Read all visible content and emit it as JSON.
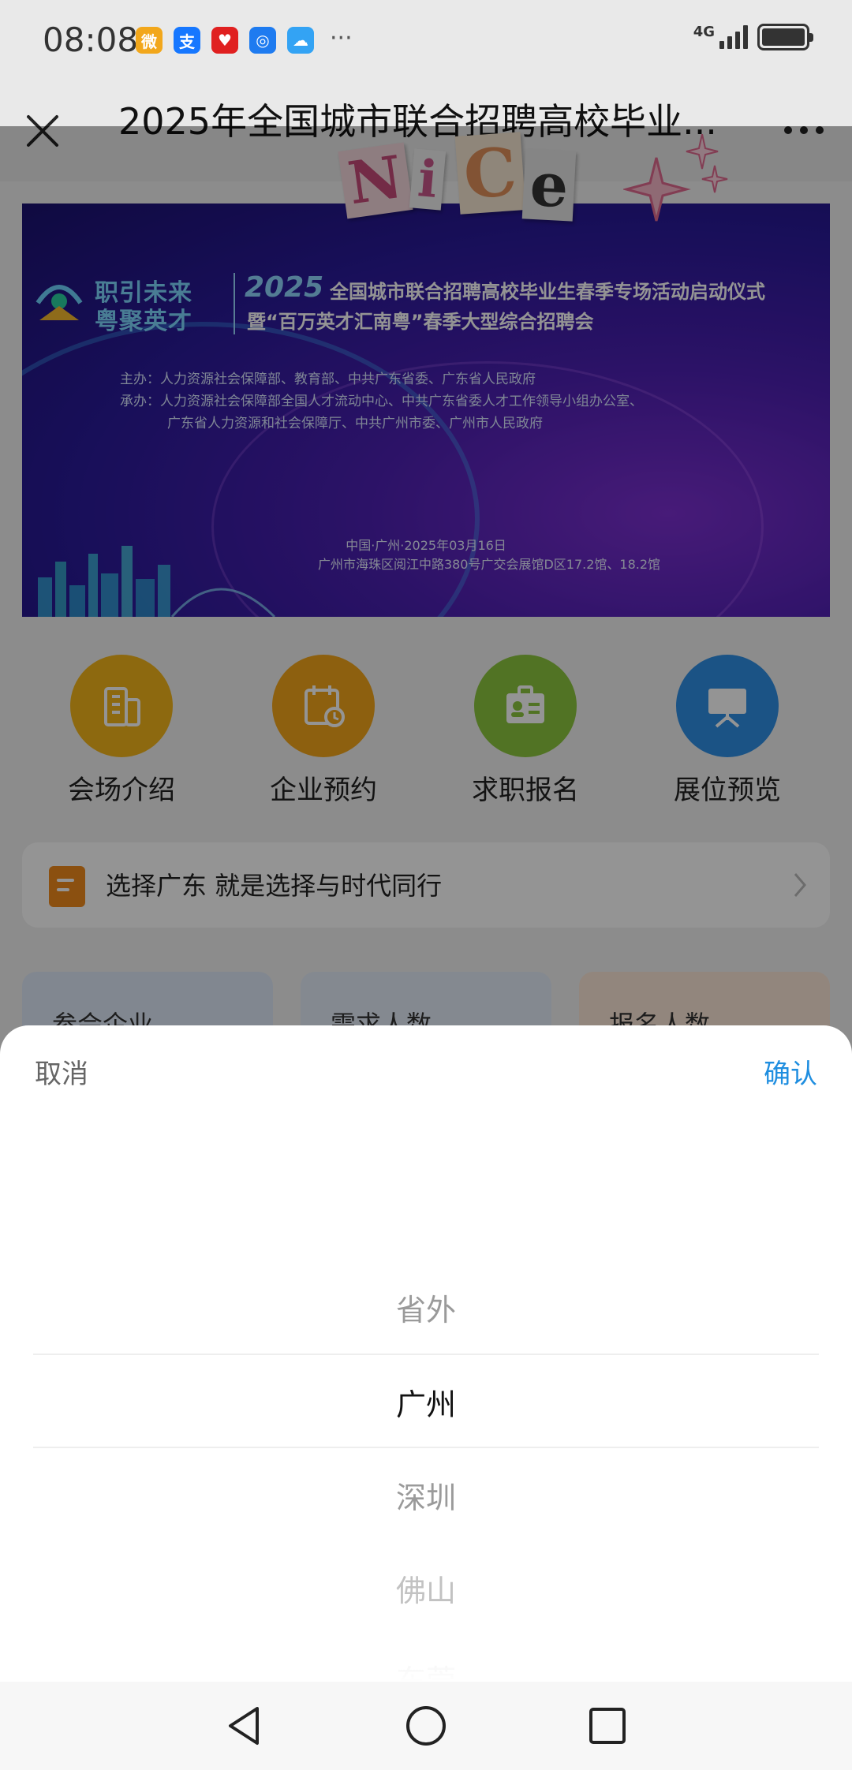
{
  "status_bar": {
    "time": "08:08",
    "network": "4G",
    "apps": [
      {
        "name": "weibo-icon",
        "color": "#f2a71b",
        "glyph": "微"
      },
      {
        "name": "alipay-icon",
        "color": "#1677ff",
        "glyph": "支"
      },
      {
        "name": "app-red-icon",
        "color": "#e02020",
        "glyph": "♥"
      },
      {
        "name": "app-blue-icon",
        "color": "#1e7bf0",
        "glyph": "◎"
      },
      {
        "name": "weather-icon",
        "color": "#33a3f4",
        "glyph": "☁"
      }
    ],
    "more": "···"
  },
  "nav": {
    "title": "2025年全国城市联合招聘高校毕业..."
  },
  "sticker": {
    "letters": [
      "N",
      "i",
      "C",
      "e"
    ]
  },
  "banner": {
    "slogan_line1": "职引未来",
    "slogan_line2": "粤聚英才",
    "year": "2025",
    "heading_line1": "全国城市联合招聘高校毕业生春季专场活动启动仪式",
    "heading_line2": "暨“百万英才汇南粤”春季大型综合招聘会",
    "host": "主办：人力资源社会保障部、教育部、中共广东省委、广东省人民政府",
    "organizer_line1": "承办：人力资源社会保障部全国人才流动中心、中共广东省委人才工作领导小组办公室、",
    "organizer_line2": "广东省人力资源和社会保障厅、中共广州市委、广州市人民政府",
    "date": "中国·广州·2025年03月16日",
    "address": "广州市海珠区阅江中路380号广交会展馆D区17.2馆、18.2馆"
  },
  "quick_links": [
    {
      "label": "会场介绍",
      "color": "#f3b51b",
      "icon": "building-icon"
    },
    {
      "label": "企业预约",
      "color": "#f3a51b",
      "icon": "calendar-icon"
    },
    {
      "label": "求职报名",
      "color": "#8cc63f",
      "icon": "id-card-icon"
    },
    {
      "label": "展位预览",
      "color": "#2f8fe6",
      "icon": "presentation-board-icon"
    }
  ],
  "slogan": {
    "text": "选择广东 就是选择与时代同行"
  },
  "stats": [
    {
      "label": "参会企业",
      "color": "#dfe9f8"
    },
    {
      "label": "需求人数",
      "color": "#e4ecf8"
    },
    {
      "label": "报名人数",
      "color": "#fbe7d8"
    }
  ],
  "picker": {
    "cancel": "取消",
    "confirm": "确认",
    "options": [
      "省外",
      "广州",
      "深圳",
      "佛山",
      "东莞"
    ],
    "selected": "广州"
  }
}
